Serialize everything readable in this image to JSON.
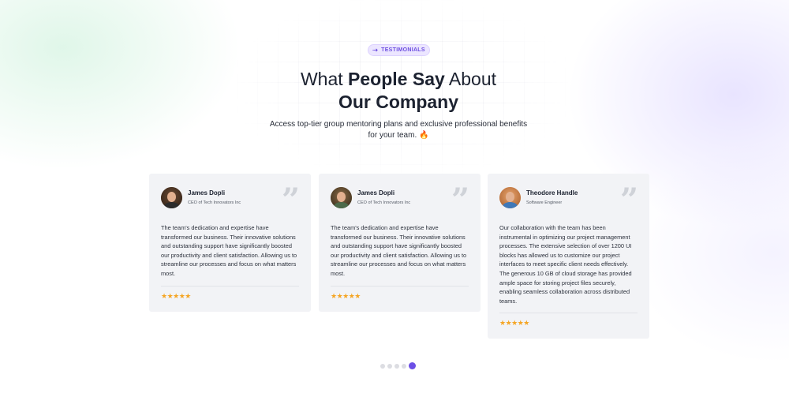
{
  "section": {
    "badge_icon": "arrow-icon",
    "badge_label": "TESTIMONIALS",
    "title_pre": "What ",
    "title_bold1": "People Say",
    "title_mid": " About",
    "title_bold2": "Our Company",
    "subtitle": "Access top-tier group mentoring plans and exclusive professional benefits for your team. 🔥"
  },
  "testimonials": [
    {
      "name": "James Dopli",
      "role": "CEO of Tech Innovators Inc",
      "text": "The team's dedication and expertise have transformed our business. Their innovative solutions and outstanding support have significantly boosted our productivity and client satisfaction. Allowing us to streamline our processes and focus on what matters most.",
      "rating": 5,
      "stars": "★★★★★"
    },
    {
      "name": "James Dopli",
      "role": "CEO of Tech Innovators Inc",
      "text": "The team's dedication and expertise have transformed our business. Their innovative solutions and outstanding support have significantly boosted our productivity and client satisfaction. Allowing us to streamline our processes and focus on what matters most.",
      "rating": 5,
      "stars": "★★★★★"
    },
    {
      "name": "Theodore Handle",
      "role": "Software Engineer",
      "text": "Our collaboration with the team has been instrumental in optimizing our project management processes. The extensive selection of over 1200 UI blocks has allowed us to customize our project interfaces to meet specific client needs effectively. The generous 10 GB of cloud storage has provided ample space for storing project files securely, enabling seamless collaboration across distributed teams.",
      "rating": 5,
      "stars": "★★★★★"
    }
  ],
  "quote_glyph": "”",
  "pagination": {
    "count": 5,
    "active_index": 4
  },
  "colors": {
    "accent": "#6c4fe6",
    "star": "#f5a524",
    "card_bg": "#f2f3f6"
  }
}
